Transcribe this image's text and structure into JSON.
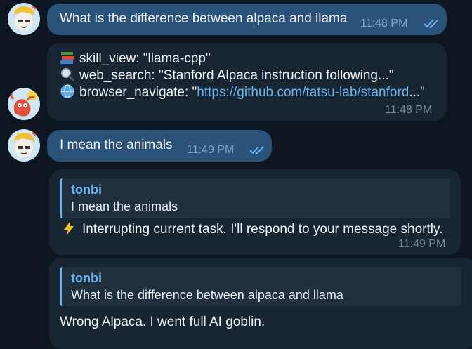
{
  "messages": [
    {
      "id": "user-1",
      "sender": "user",
      "text": "What is the difference between alpaca and llama",
      "time": "11:48 PM"
    },
    {
      "id": "bot-tools",
      "sender": "bot",
      "tools": [
        {
          "icon": "books-icon",
          "prefix": "skill_view: \"llama-cpp\"",
          "link": "",
          "suffix": ""
        },
        {
          "icon": "magnifier-icon",
          "prefix": "web_search: \"Stanford Alpaca instruction following...\"",
          "link": "",
          "suffix": ""
        },
        {
          "icon": "globe-icon",
          "prefix": "browser_navigate: \"",
          "link": "https://github.com/tatsu-lab/stanford",
          "suffix": "...\""
        }
      ],
      "time": "11:48 PM"
    },
    {
      "id": "user-2",
      "sender": "user",
      "text": "I mean the animals",
      "time": "11:49 PM"
    },
    {
      "id": "bot-reply-1",
      "sender": "bot",
      "reply_to": {
        "author": "tonbi",
        "text": "I mean the animals"
      },
      "icon": "lightning-icon",
      "text": "Interrupting current task. I'll respond to your message shortly.",
      "time": "11:49 PM"
    },
    {
      "id": "bot-reply-2",
      "sender": "bot",
      "reply_to": {
        "author": "tonbi",
        "text": "What is the difference between alpaca and llama"
      },
      "text": "Wrong Alpaca. I went full AI goblin."
    }
  ],
  "colors": {
    "background": "#0e1621",
    "outgoing_bubble": "#2b5278",
    "incoming_bubble": "#182533",
    "link": "#6ab3f3",
    "quote_bar": "#6ab3f3"
  }
}
